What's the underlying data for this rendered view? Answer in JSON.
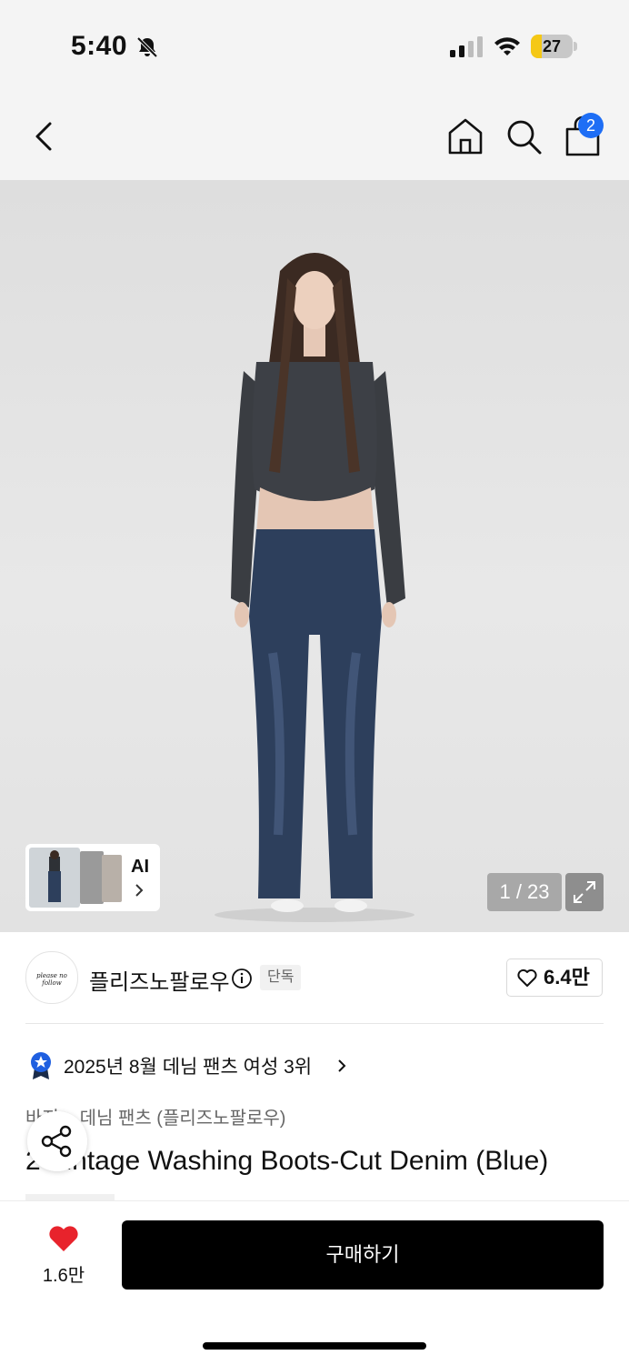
{
  "status_bar": {
    "time": "5:40",
    "battery_percent": "27",
    "battery_level": 0.27,
    "battery_color": "#f5c816",
    "icons": [
      "bell-slash-icon",
      "cellular-signal-icon",
      "wifi-icon",
      "battery-icon"
    ]
  },
  "header": {
    "icons": [
      "back-icon",
      "home-icon",
      "search-icon",
      "shopping-bag-icon"
    ],
    "cart_count": "2",
    "cart_badge_color": "#1e6ef5"
  },
  "gallery": {
    "ai_label": "AI",
    "page_counter": "1 / 23",
    "icons": [
      "chevron-right-icon",
      "expand-icon"
    ]
  },
  "brand": {
    "name": "플리즈노팔로우",
    "badge": "단독",
    "likes": "6.4만",
    "icons": [
      "info-icon",
      "heart-outline-icon"
    ]
  },
  "ranking": {
    "text": "2025년 8월 데님 팬츠 여성 3위",
    "icons": [
      "rank-badge-icon",
      "chevron-right-icon"
    ]
  },
  "product": {
    "breadcrumb": "바지 > 데님 팬츠 (플리즈노팔로우)",
    "title": "2 Vintage Washing Boots-Cut Denim (Blue)"
  },
  "bottom_bar": {
    "wish_count": "1.6만",
    "buy_label": "구매하기",
    "heart_color": "#e8232c",
    "icons": [
      "heart-filled-icon",
      "share-icon"
    ]
  }
}
